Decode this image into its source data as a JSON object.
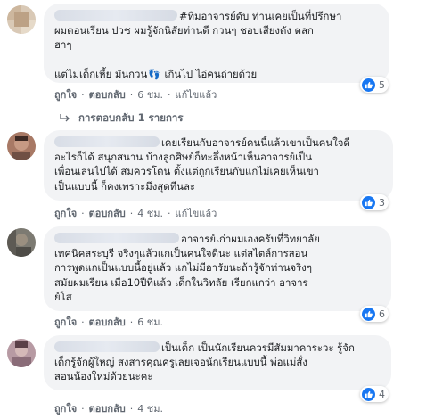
{
  "comments": [
    {
      "text": "#ทีมอาจารย์ดับ ท่านเคยเป็นที่ปรึกษา\nผมตอนเรียน ปวช ผมรู้จักนิสัยท่านดี กวนๆ ชอบเสียงดัง ตลก\nฮาๆ\n\nแต่ไม่เด็กเหี้ย มันกวน",
      "text_after_icon": " เกินไป ไอ่คนถ่ายด้วย",
      "like_label": "ถูกใจ",
      "reply_label": "ตอบกลับ",
      "time": "6 ชม.",
      "edited": "แก้ไขแล้ว",
      "reaction_count": "5"
    },
    {
      "text": "เคยเรียนกับอาจารย์คนนี้แล้วเขาเป็นคนใจดี\nอะไรก็ได้ สนุกสนาน บ้างลูกศิษย์ก็ทะลึ่งหน้าเห็นอาจารย์เป็น\nเพื่อนเล่นไปได้ สมควรโดน ตั้งแต่ถูกเรียนกับแกไม่เคยเห็นเขา\nเป็นแบบนี้ ก็คงเพราะมึงสุดทีนละ",
      "like_label": "ถูกใจ",
      "reply_label": "ตอบกลับ",
      "time": "4 ชม.",
      "edited": "แก้ไขแล้ว",
      "reaction_count": "3"
    },
    {
      "text": "อาจารย์เก่าผมเองครับที่วิทยาลัย\nเทคนิคสระบุรี จริงๆแล้วแกเป็นคนใจดีนะ แต่สไตล์การสอน\nการพูดแกเป็นแบบนี้อยู่แล้ว แกไม่มีอารัยนะถ้ารู้จักท่านจริงๆ\nสมัยผมเรียน เมื่อ10ปีที่แล้ว เด็กในวิทลัย เรียกแกว่า อาจาร\nย์โส",
      "like_label": "ถูกใจ",
      "reply_label": "ตอบกลับ",
      "time": "6 ชม.",
      "reaction_count": "6"
    },
    {
      "text": "เป็นเด็ก เป็นนักเรียนควรมีสัมมาคาระวะ รู้จัก\nเด็กรู้จักผู้ใหญ่ สงสารคุณครูเลยเจอนักเรียนแบบนี้ พ่อแม่สั่ง\nสอนน้องใหม่ด้วยนะคะ",
      "like_label": "ถูกใจ",
      "reply_label": "ตอบกลับ",
      "time": "4 ชม.",
      "reaction_count": "4"
    }
  ],
  "replies_label": "การตอบกลับ 1 รายการ",
  "colors": {
    "accent": "#1877f2",
    "bubble": "#f2f3f5",
    "meta": "#606770"
  }
}
